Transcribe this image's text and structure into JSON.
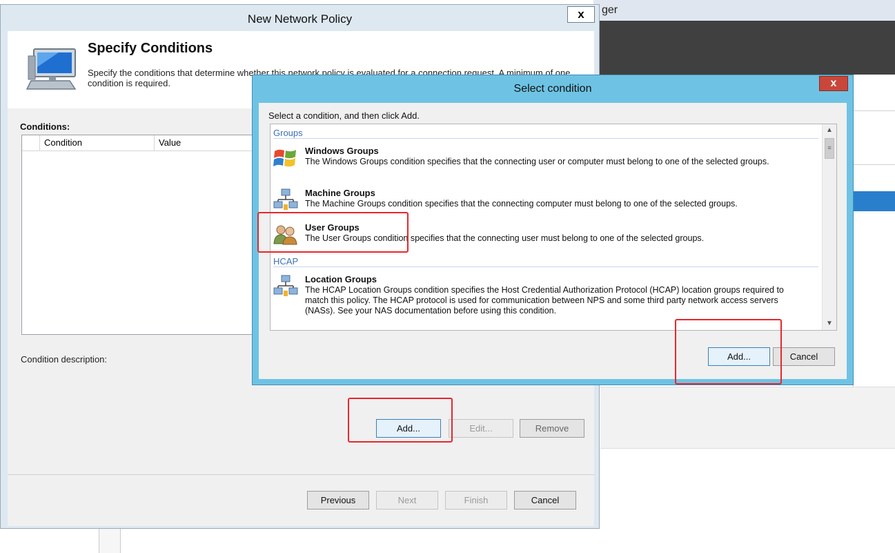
{
  "background": {
    "title_fragment": "ger"
  },
  "wizard": {
    "title": "New Network Policy",
    "close_label": "x",
    "heading": "Specify Conditions",
    "description": "Specify the conditions that determine whether this network policy is evaluated for a connection request. A minimum of one condition is required.",
    "conditions_label": "Conditions:",
    "columns": [
      "Condition",
      "Value"
    ],
    "condition_description_label": "Condition description:",
    "buttons": {
      "add": "Add...",
      "edit": "Edit...",
      "remove": "Remove",
      "previous": "Previous",
      "next": "Next",
      "finish": "Finish",
      "cancel": "Cancel"
    }
  },
  "dialog": {
    "title": "Select condition",
    "close_label": "x",
    "instruction": "Select a condition, and then click Add.",
    "groups": [
      {
        "header": "Groups",
        "items": [
          {
            "title": "Windows Groups",
            "icon": "windows-groups-icon",
            "description": "The Windows Groups condition specifies that the connecting user or computer must belong to one of the selected groups."
          },
          {
            "title": "Machine Groups",
            "icon": "machine-groups-icon",
            "description": "The Machine Groups condition specifies that the connecting computer must belong to one of the selected groups."
          },
          {
            "title": "User Groups",
            "icon": "user-groups-icon",
            "description": "The User Groups condition specifies that the connecting user must belong to one of the selected groups."
          }
        ]
      },
      {
        "header": "HCAP",
        "items": [
          {
            "title": "Location Groups",
            "icon": "location-groups-icon",
            "description": "The HCAP Location Groups condition specifies the Host Credential Authorization Protocol (HCAP) location groups required to match this policy. The HCAP protocol is used for communication between NPS and some third party network access servers (NASs). See your NAS documentation before using this condition."
          }
        ]
      }
    ],
    "buttons": {
      "add": "Add...",
      "cancel": "Cancel"
    }
  },
  "colors": {
    "dialog_frame": "#6ec3e4",
    "close_red": "#c9473a",
    "annotation_red": "#e8262b",
    "group_header_blue": "#3d6fb3"
  }
}
